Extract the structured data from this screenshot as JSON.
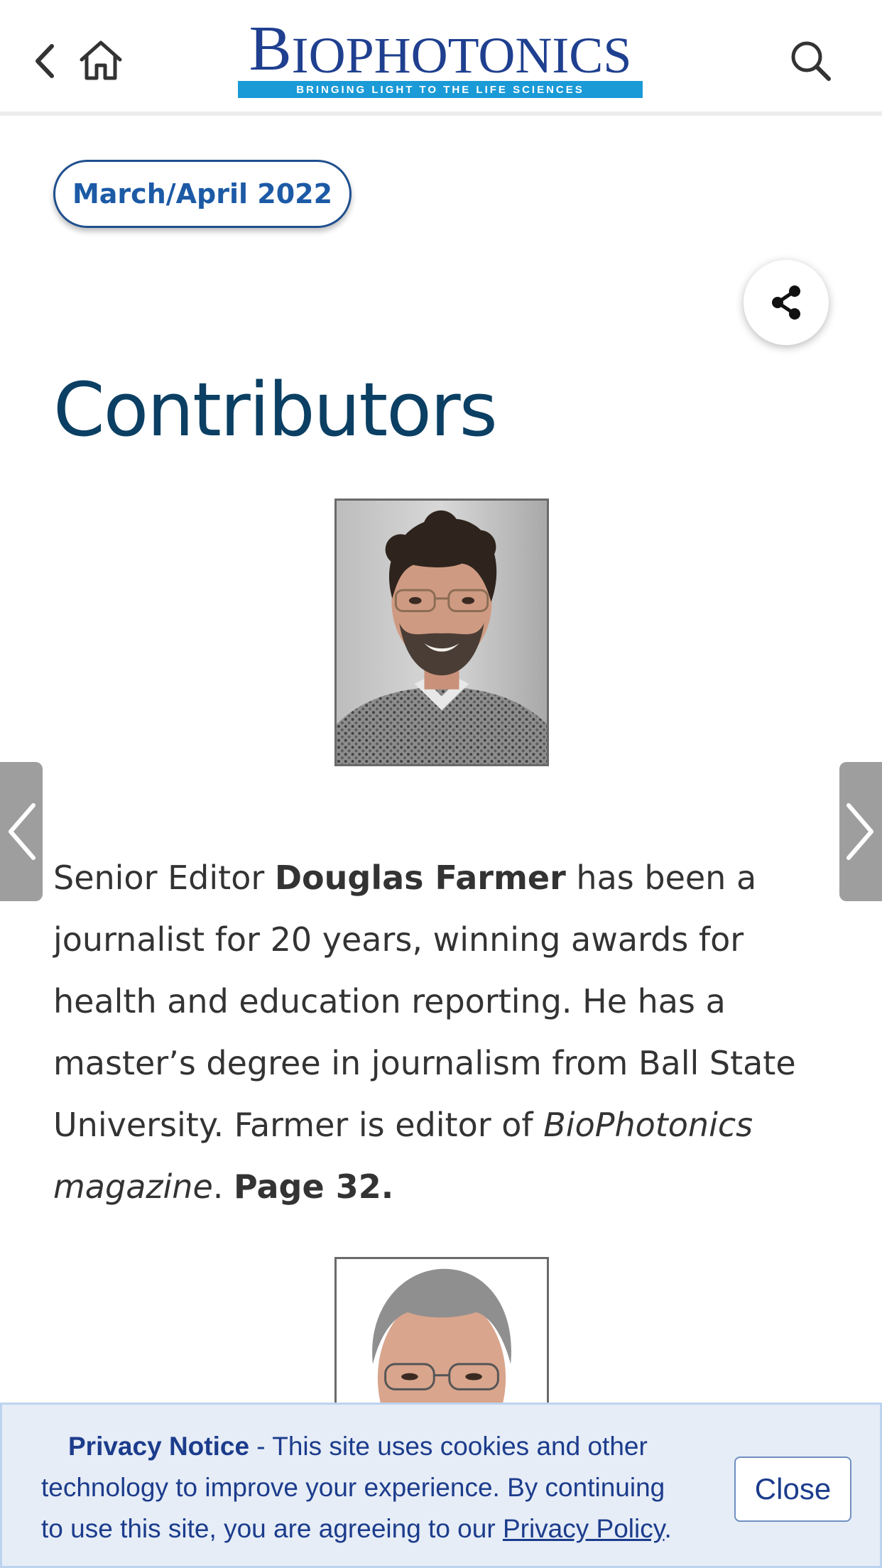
{
  "header": {
    "logo_word_first": "B",
    "logo_word_rest": "IOPHOTONICS",
    "logo_tagline": "BRINGING LIGHT TO THE LIFE SCIENCES",
    "back_icon": "chevron-left-icon",
    "home_icon": "home-icon",
    "search_icon": "search-icon"
  },
  "issue": {
    "label": "March/April 2022"
  },
  "share": {
    "icon": "share-icon"
  },
  "page": {
    "title": "Contributors"
  },
  "bio": {
    "line1_pre": "Senior Editor ",
    "line1_name": "Douglas Farmer",
    "line1_post": " has been a",
    "line2": "journalist for 20 years, winning awards for",
    "line3": "health and education reporting. He has a",
    "line4": "master’s degree in journalism from Ball State",
    "line5_pre": "University. Farmer is editor of ",
    "line5_italic": "BioPhotonics",
    "line6_italic": "magazine",
    "line6_mid": ". ",
    "line6_bold": "Page 32."
  },
  "nav": {
    "prev_icon": "chevron-left-icon",
    "next_icon": "chevron-right-icon"
  },
  "privacy": {
    "title": "Privacy Notice",
    "line1_rest": " - This site uses cookies and other",
    "line2": "technology to improve your experience. By continuing",
    "line3_pre": "to use this site, you are agreeing to our ",
    "link": "Privacy Policy",
    "line3_post": ".",
    "close_label": "Close"
  },
  "colors": {
    "title": "#0b3f63",
    "accent": "#1c5aa6",
    "logo_blue": "#1f3f8f",
    "logo_bar": "#1a9ad7",
    "privacy_bg": "#e6edf7"
  }
}
